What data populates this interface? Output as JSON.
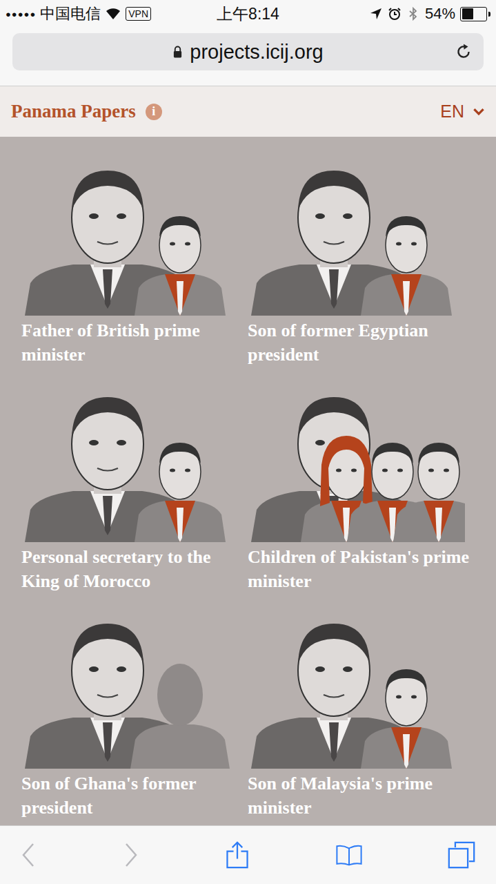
{
  "status_bar": {
    "signal": "●●●●●",
    "carrier": "中国电信",
    "vpn": "VPN",
    "time": "上午8:14",
    "battery_text": "54%",
    "battery_level": 0.54
  },
  "address_bar": {
    "url": "projects.icij.org"
  },
  "site_header": {
    "title": "Panama Papers",
    "info": "i",
    "language": "EN"
  },
  "cards": [
    {
      "caption": "Father of British prime minister",
      "relatives": [
        {
          "kind": "man"
        }
      ]
    },
    {
      "caption": "Son of former Egyptian president",
      "relatives": [
        {
          "kind": "man"
        }
      ]
    },
    {
      "caption": "Personal secretary to the King of Morocco",
      "relatives": [
        {
          "kind": "man"
        }
      ]
    },
    {
      "caption": "Children of Pakistan's prime minister",
      "relatives": [
        {
          "kind": "woman"
        },
        {
          "kind": "man"
        },
        {
          "kind": "man"
        }
      ]
    },
    {
      "caption": "Son of Ghana's former president",
      "relatives": [
        {
          "kind": "silhouette"
        }
      ]
    },
    {
      "caption": "Son of Malaysia's prime minister",
      "relatives": [
        {
          "kind": "man"
        }
      ]
    }
  ],
  "toolbar": {
    "back_disabled": true,
    "forward_disabled": true
  }
}
